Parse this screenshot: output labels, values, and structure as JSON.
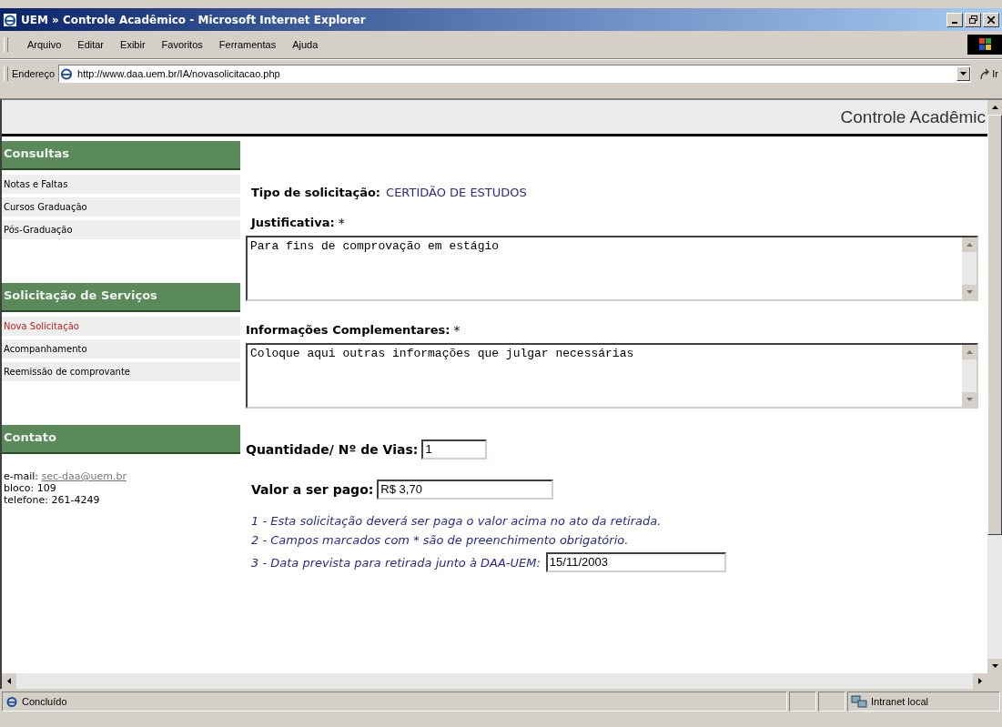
{
  "window": {
    "title": "UEM » Controle Acadêmico - Microsoft Internet Explorer"
  },
  "menu": [
    "Arquivo",
    "Editar",
    "Exibir",
    "Favoritos",
    "Ferramentas",
    "Ajuda"
  ],
  "address_bar": {
    "label": "Endereço",
    "value": "http://www.daa.uem.br/IA/novasolicitacao.php",
    "go": "Ir"
  },
  "page_header": "Controle Acadêmic",
  "sidebar": [
    {
      "title": "Consultas",
      "items": [
        {
          "label": "Notas e Faltas",
          "selected": false
        },
        {
          "label": "Cursos Graduação",
          "selected": false
        },
        {
          "label": "Pós-Graduação",
          "selected": false
        }
      ]
    },
    {
      "title": "Solicitação de Serviços",
      "items": [
        {
          "label": "Nova Solicitação",
          "selected": true
        },
        {
          "label": "Acompanhamento",
          "selected": false
        },
        {
          "label": "Reemissão de comprovante",
          "selected": false
        }
      ]
    },
    {
      "title": "Contato",
      "contact": {
        "email_label": "e-mail:",
        "email": "sec-daa@uem.br",
        "lines": [
          "bloco: 109",
          "telefone: 261-4249"
        ]
      }
    }
  ],
  "form": {
    "type_label": "Tipo de solicitação:",
    "type_value": "CERTIDÃO DE ESTUDOS",
    "justification": {
      "label": "Justificativa:",
      "required": "*",
      "value": "Para fins de comprovação em estágio"
    },
    "extra_info": {
      "label": "Informações Complementares:",
      "required": "*",
      "value": "Coloque aqui outras informações que julgar necessárias"
    },
    "quantity": {
      "label": "Quantidade/ Nº de Vias:",
      "value": "1"
    },
    "price": {
      "label": "Valor a ser pago:",
      "value": "R$ 3,70"
    },
    "notes": [
      "1 - Esta solicitação deverá ser paga o valor acima no ato da retirada.",
      "2 - Campos marcados com * são de preenchimento obrigatório."
    ],
    "date": {
      "label": "3 - Data prevista para retirada junto à DAA-UEM:",
      "value": "15/11/2003"
    }
  },
  "status_bar": {
    "text": "Concluído",
    "zone": "Intranet local"
  }
}
